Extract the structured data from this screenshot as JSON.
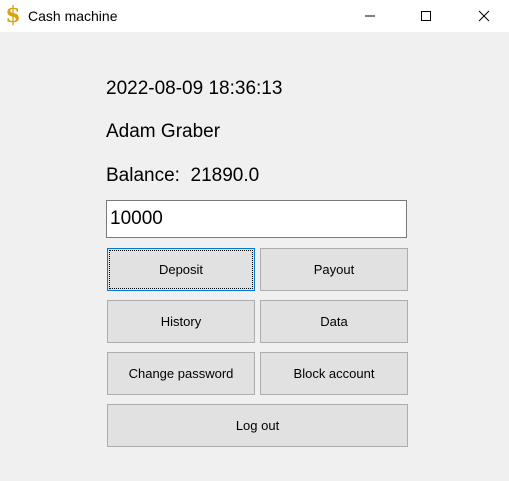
{
  "window": {
    "title": "Cash machine",
    "icon": "dollar-sign-icon",
    "controls": [
      "minimize-icon",
      "maximize-icon",
      "close-icon"
    ]
  },
  "info": {
    "datetime": "2022-08-09 18:36:13",
    "user_name": "Adam Graber",
    "balance_label": "Balance:",
    "balance_value": "21890.0"
  },
  "amount_input": {
    "value": "10000"
  },
  "buttons": {
    "deposit": "Deposit",
    "payout": "Payout",
    "history": "History",
    "data": "Data",
    "change_password": "Change password",
    "block_account": "Block account",
    "log_out": "Log out"
  },
  "colors": {
    "window_bg": "#f0f0f0",
    "button_bg": "#e1e1e1",
    "button_border": "#adadad",
    "focus_border": "#0078d7",
    "icon_gold": "#d9a20f"
  }
}
